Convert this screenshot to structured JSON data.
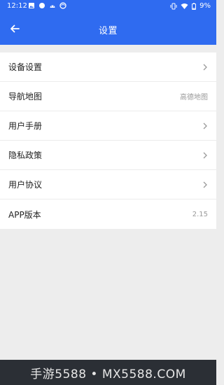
{
  "status_bar": {
    "time": "12:12",
    "battery": "9%",
    "icons": [
      "image-icon",
      "circle-icon",
      "android-icon",
      "sync-icon",
      "vibrate-icon",
      "wifi-icon",
      "battery-icon"
    ]
  },
  "app_bar": {
    "title": "设置",
    "back_icon": "arrow-left-icon"
  },
  "settings": {
    "items": [
      {
        "label": "设备设置",
        "value": "",
        "chevron": true
      },
      {
        "label": "导航地图",
        "value": "高德地图",
        "chevron": false
      },
      {
        "label": "用户手册",
        "value": "",
        "chevron": true
      },
      {
        "label": "隐私政策",
        "value": "",
        "chevron": true
      },
      {
        "label": "用户协议",
        "value": "",
        "chevron": true
      },
      {
        "label": "APP版本",
        "value": "2.15",
        "chevron": false
      }
    ]
  },
  "watermark": {
    "text": "手游5588 • MX5588.COM"
  },
  "colors": {
    "primary": "#2f6bf0",
    "background": "#ededed",
    "watermark_bg": "#2b2f35"
  }
}
